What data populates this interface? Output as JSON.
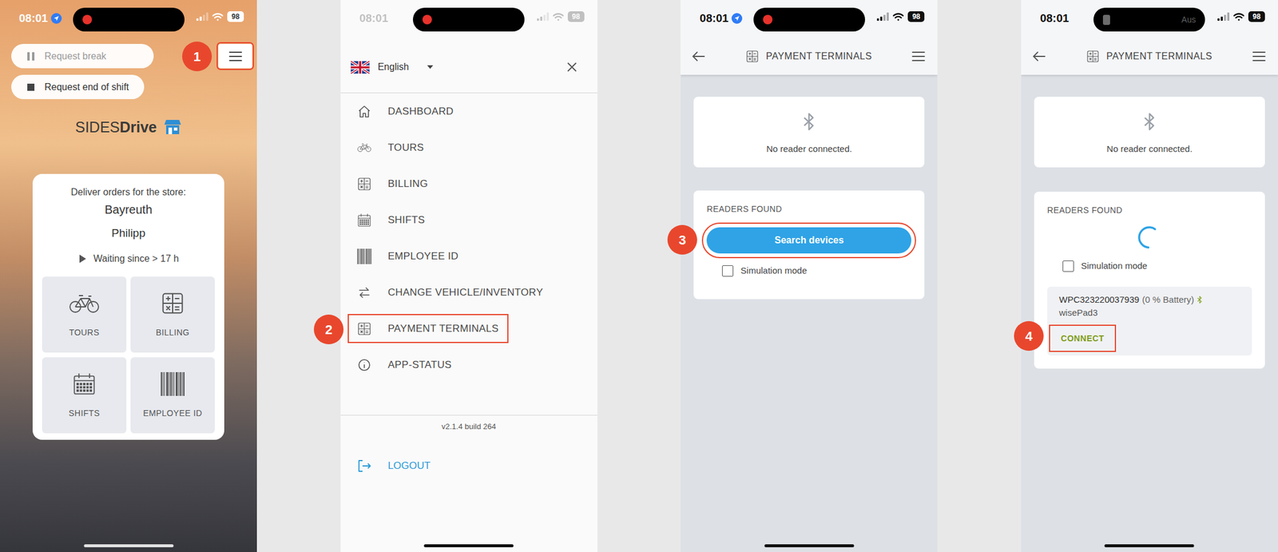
{
  "steps": [
    {
      "number": "1"
    },
    {
      "number": "2"
    },
    {
      "number": "3"
    },
    {
      "number": "4"
    }
  ],
  "screen1": {
    "status": {
      "time": "08:01",
      "battery": "98",
      "recording": true,
      "location": true,
      "faded": false
    },
    "request_break": {
      "label": "Request break",
      "disabled": true
    },
    "request_end": {
      "label": "Request end of shift",
      "disabled": false
    },
    "menu_button": {
      "highlighted": true
    },
    "brand": {
      "first": "SIDES",
      "second": "Drive"
    },
    "card": {
      "subtitle": "Deliver orders for the store:",
      "store": "Bayreuth",
      "driver": "Philipp",
      "waiting": "Waiting since > 17 h",
      "tiles": [
        {
          "label": "TOURS"
        },
        {
          "label": "BILLING"
        },
        {
          "label": "SHIFTS"
        },
        {
          "label": "EMPLOYEE ID"
        }
      ]
    }
  },
  "screen2": {
    "status": {
      "time": "08:01",
      "battery": "98",
      "recording": true,
      "location": false,
      "faded": true
    },
    "language": "English",
    "menu": [
      {
        "label": "DASHBOARD",
        "highlighted": false
      },
      {
        "label": "TOURS",
        "highlighted": false
      },
      {
        "label": "BILLING",
        "highlighted": false
      },
      {
        "label": "SHIFTS",
        "highlighted": false
      },
      {
        "label": "EMPLOYEE ID",
        "highlighted": false
      },
      {
        "label": "CHANGE VEHICLE/INVENTORY",
        "highlighted": false
      },
      {
        "label": "PAYMENT TERMINALS",
        "highlighted": true
      },
      {
        "label": "APP-STATUS",
        "highlighted": false
      }
    ],
    "version": "v2.1.4 build 264",
    "logout": "LOGOUT"
  },
  "screen3": {
    "status": {
      "time": "08:01",
      "battery": "98",
      "recording": true,
      "location": true,
      "faded": false
    },
    "title": "PAYMENT TERMINALS",
    "reader_status": "No reader connected.",
    "section": "READERS FOUND",
    "searching": false,
    "search_button": {
      "label": "Search devices",
      "highlighted": true
    },
    "simulation": {
      "label": "Simulation mode",
      "checked": false
    },
    "devices": []
  },
  "screen4": {
    "status": {
      "time": "08:01",
      "battery": "98",
      "recording": false,
      "location": false,
      "faded": false,
      "carrier": "Aus"
    },
    "title": "PAYMENT TERMINALS",
    "reader_status": "No reader connected.",
    "section": "READERS FOUND",
    "searching": true,
    "simulation": {
      "label": "Simulation mode",
      "checked": false
    },
    "devices": [
      {
        "id": "WPC323220037939",
        "battery": "(0 % Battery)",
        "model": "wisePad3",
        "connect": {
          "label": "CONNECT",
          "highlighted": true
        }
      }
    ]
  }
}
